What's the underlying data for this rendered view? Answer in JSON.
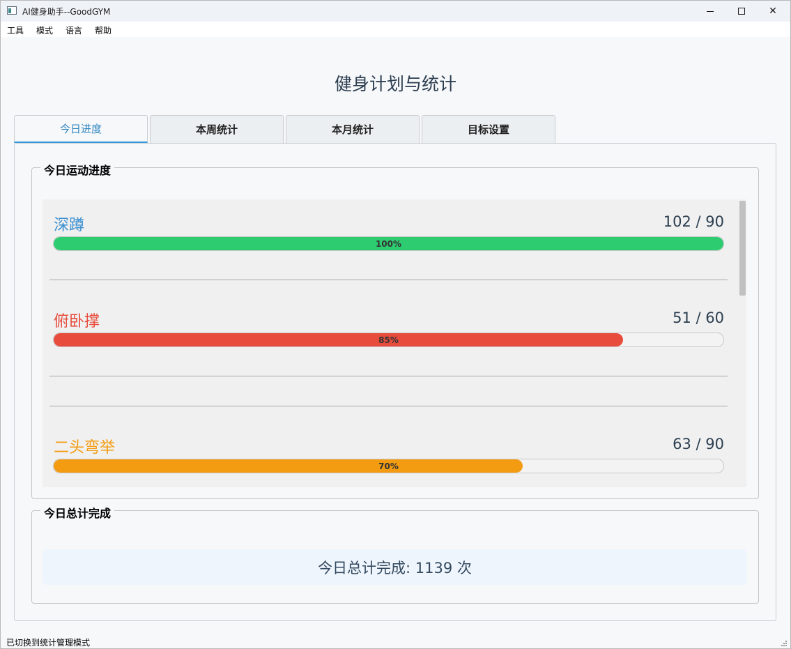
{
  "window": {
    "title": "AI健身助手--GoodGYM",
    "controls": {
      "minimize": "",
      "maximize": "",
      "close": "✕"
    }
  },
  "menu": [
    "工具",
    "模式",
    "语言",
    "帮助"
  ],
  "page_title": "健身计划与统计",
  "tabs": [
    {
      "label": "今日进度",
      "active": true
    },
    {
      "label": "本周统计",
      "active": false
    },
    {
      "label": "本月统计",
      "active": false
    },
    {
      "label": "目标设置",
      "active": false
    }
  ],
  "progress_group": {
    "title": "今日运动进度",
    "exercises": [
      {
        "name": "深蹲",
        "count": "102 / 90",
        "percent_label": "100%",
        "fill_fraction": 1.0,
        "name_color": "#3a8fd0",
        "bar_color": "#2ecc71"
      },
      {
        "name": "俯卧撑",
        "count": "51 / 60",
        "percent_label": "85%",
        "fill_fraction": 0.85,
        "name_color": "#e74c3c",
        "bar_color": "#e74c3c"
      },
      {
        "name": "二头弯举",
        "count": "63 / 90",
        "percent_label": "70%",
        "fill_fraction": 0.7,
        "name_color": "#f39c12",
        "bar_color": "#f39c12"
      }
    ]
  },
  "total_group": {
    "title": "今日总计完成",
    "text": "今日总计完成: 1139 次"
  },
  "status": "已切换到统计管理模式"
}
